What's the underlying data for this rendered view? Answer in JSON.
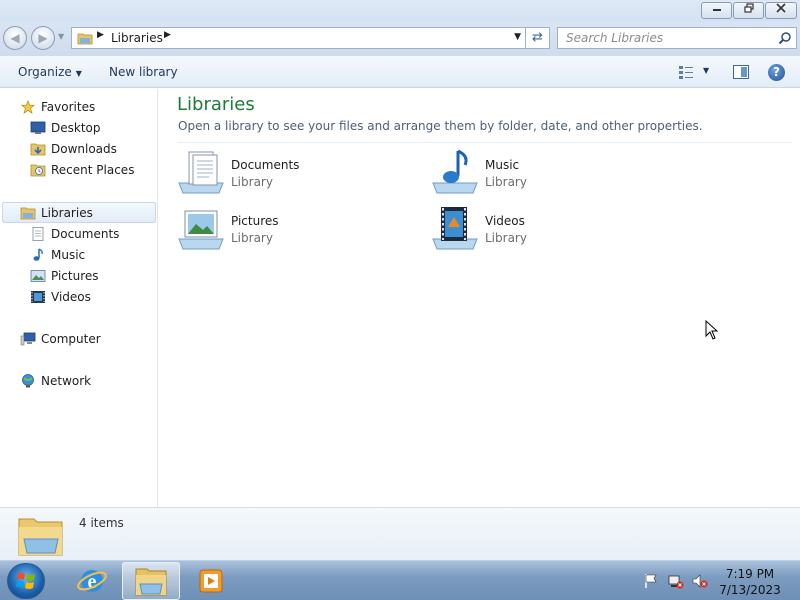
{
  "window": {
    "controls": {
      "minimize_icon": "minimize-icon",
      "maximize_icon": "restore-icon",
      "close_icon": "close-icon"
    }
  },
  "address": {
    "crumb": "Libraries",
    "search_placeholder": "Search Libraries"
  },
  "toolbar": {
    "organize": "Organize",
    "new_library": "New library"
  },
  "nav": {
    "favorites": "Favorites",
    "desktop": "Desktop",
    "downloads": "Downloads",
    "recent_places": "Recent Places",
    "libraries": "Libraries",
    "documents": "Documents",
    "music": "Music",
    "pictures": "Pictures",
    "videos": "Videos",
    "computer": "Computer",
    "network": "Network"
  },
  "content": {
    "title": "Libraries",
    "subtitle": "Open a library to see your files and arrange them by folder, date, and other properties.",
    "libraries": [
      {
        "name": "Documents",
        "type": "Library",
        "icon": "documents-library-icon"
      },
      {
        "name": "Music",
        "type": "Library",
        "icon": "music-library-icon"
      },
      {
        "name": "Pictures",
        "type": "Library",
        "icon": "pictures-library-icon"
      },
      {
        "name": "Videos",
        "type": "Library",
        "icon": "videos-library-icon"
      }
    ]
  },
  "details": {
    "count": "4 items"
  },
  "taskbar": {
    "time": "7:19 PM",
    "date": "7/13/2023"
  },
  "colors": {
    "title_green": "#1e7b34",
    "accent_blue": "#1d4f97"
  }
}
